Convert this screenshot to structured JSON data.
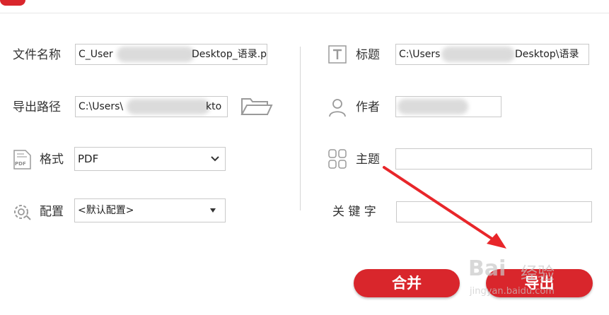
{
  "form": {
    "filename_label": "文件名称",
    "filename_value_prefix": "C_User",
    "filename_value_suffix": "Desktop_语录.p",
    "export_path_label": "导出路径",
    "export_path_value_prefix": "C:\\Users\\",
    "export_path_value_suffix": "kto",
    "format_label": "格式",
    "format_value": "PDF",
    "config_label": "配置",
    "config_value": "<默认配置>",
    "title_label": "标题",
    "title_value_prefix": "C:\\Users",
    "title_value_suffix": "Desktop\\语录",
    "author_label": "作者",
    "author_value": "",
    "subject_label": "主题",
    "subject_value": "",
    "keywords_label": "关 键 字",
    "keywords_value": ""
  },
  "icons": {
    "folder": "folder-icon",
    "pdf": "pdf-file-icon",
    "config": "gear-icon",
    "title": "text-t-icon",
    "author": "person-icon",
    "subject": "grid-icon"
  },
  "buttons": {
    "merge_label": "合并",
    "export_label": "导出"
  },
  "watermark": {
    "brand": "Bai",
    "brand_suffix": "经验",
    "url": "jingyan.baidu.com"
  },
  "colors": {
    "accent": "#d9262c",
    "annotation_arrow": "#e8262a"
  }
}
